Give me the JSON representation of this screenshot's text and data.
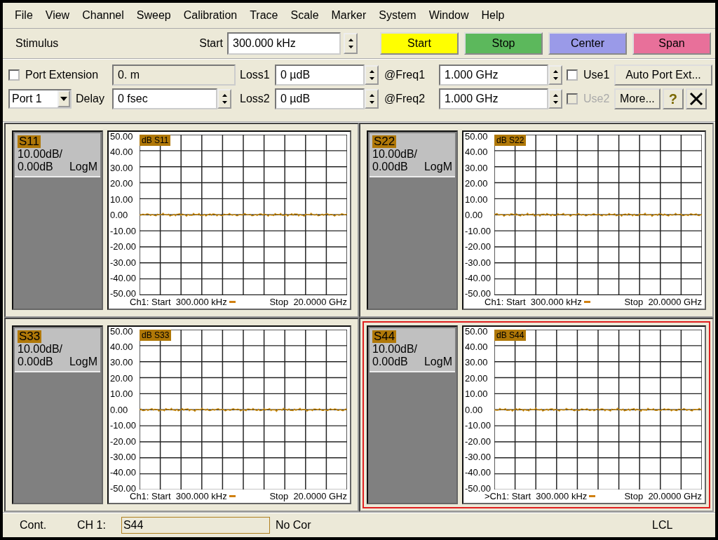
{
  "menu": [
    "File",
    "View",
    "Channel",
    "Sweep",
    "Calibration",
    "Trace",
    "Scale",
    "Marker",
    "System",
    "Window",
    "Help"
  ],
  "stimulus": {
    "label": "Stimulus",
    "field_label": "Start",
    "value": "300.000 kHz",
    "buttons": [
      {
        "label": "Start",
        "color": "#ffff00"
      },
      {
        "label": "Stop",
        "color": "#5cb85c"
      },
      {
        "label": "Center",
        "color": "#9a9ae8"
      },
      {
        "label": "Span",
        "color": "#e8709a"
      }
    ]
  },
  "port_extension": {
    "checked": false,
    "label": "Port Extension",
    "length": "0. m",
    "port": "Port 1",
    "delay_label": "Delay",
    "delay": "0 fsec",
    "help": "?",
    "rows": [
      {
        "loss_label": "Loss1",
        "loss": "0 µdB",
        "freq_label": "@Freq1",
        "freq": "1.000 GHz",
        "use_label": "Use1",
        "use_checked": false,
        "use_disabled": false,
        "button": "Auto Port Ext..."
      },
      {
        "loss_label": "Loss2",
        "loss": "0 µdB",
        "freq_label": "@Freq2",
        "freq": "1.000 GHz",
        "use_label": "Use2",
        "use_checked": false,
        "use_disabled": true,
        "button": "More..."
      }
    ]
  },
  "panes": [
    {
      "trace": "S11",
      "scale": "10.00dB/",
      "ref": "0.00dB",
      "format": "LogM",
      "plot_label": "dB S11",
      "yticks": [
        "50.00",
        "40.00",
        "30.00",
        "20.00",
        "10.00",
        "0.00",
        "-10.00",
        "-20.00",
        "-30.00",
        "-40.00",
        "-50.00"
      ],
      "footer_start": "Ch1: Start  300.000 kHz",
      "footer_stop": "Stop  20.0000 GHz",
      "selected": false
    },
    {
      "trace": "S22",
      "scale": "10.00dB/",
      "ref": "0.00dB",
      "format": "LogM",
      "plot_label": "dB S22",
      "yticks": [
        "50.00",
        "40.00",
        "30.00",
        "20.00",
        "10.00",
        "0.00",
        "-10.00",
        "-20.00",
        "-30.00",
        "-40.00",
        "-50.00"
      ],
      "footer_start": "Ch1: Start  300.000 kHz",
      "footer_stop": "Stop  20.0000 GHz",
      "selected": false
    },
    {
      "trace": "S33",
      "scale": "10.00dB/",
      "ref": "0.00dB",
      "format": "LogM",
      "plot_label": "dB S33",
      "yticks": [
        "50.00",
        "40.00",
        "30.00",
        "20.00",
        "10.00",
        "0.00",
        "-10.00",
        "-20.00",
        "-30.00",
        "-40.00",
        "-50.00"
      ],
      "footer_start": "Ch1: Start  300.000 kHz",
      "footer_stop": "Stop  20.0000 GHz",
      "selected": false
    },
    {
      "trace": "S44",
      "scale": "10.00dB/",
      "ref": "0.00dB",
      "format": "LogM",
      "plot_label": "dB S44",
      "yticks": [
        "50.00",
        "40.00",
        "30.00",
        "20.00",
        "10.00",
        "0.00",
        "-10.00",
        "-20.00",
        "-30.00",
        "-40.00",
        "-50.00"
      ],
      "footer_start": ">Ch1: Start  300.000 kHz",
      "footer_stop": "Stop  20.0000 GHz",
      "selected": true
    }
  ],
  "status_bar": {
    "mode": "Cont.",
    "channel": "CH 1:",
    "trace": "S44",
    "correction": "No Cor",
    "remote": "LCL"
  }
}
